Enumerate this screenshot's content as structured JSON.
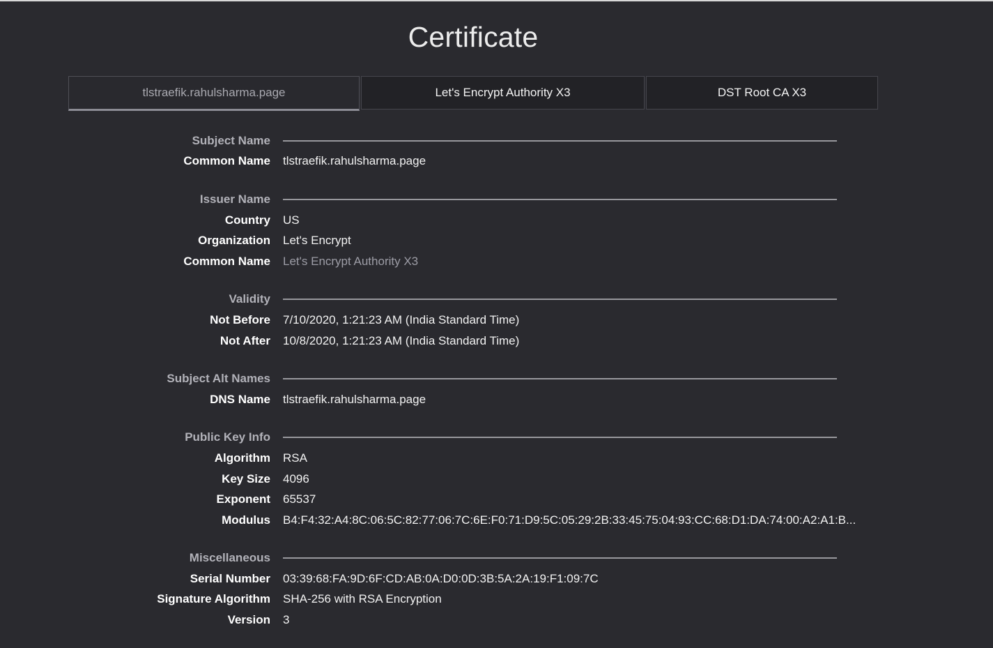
{
  "title": "Certificate",
  "tabs": [
    {
      "label": "tlstraefik.rahulsharma.page",
      "active": true
    },
    {
      "label": "Let's Encrypt Authority X3",
      "active": false
    },
    {
      "label": "DST Root CA X3",
      "active": false
    }
  ],
  "sections": {
    "subject_name": {
      "title": "Subject Name",
      "rows": [
        {
          "label": "Common Name",
          "value": "tlstraefik.rahulsharma.page"
        }
      ]
    },
    "issuer_name": {
      "title": "Issuer Name",
      "rows": [
        {
          "label": "Country",
          "value": "US"
        },
        {
          "label": "Organization",
          "value": "Let's Encrypt"
        },
        {
          "label": "Common Name",
          "value": "Let's Encrypt Authority X3"
        }
      ]
    },
    "validity": {
      "title": "Validity",
      "rows": [
        {
          "label": "Not Before",
          "value": "7/10/2020, 1:21:23 AM (India Standard Time)"
        },
        {
          "label": "Not After",
          "value": "10/8/2020, 1:21:23 AM (India Standard Time)"
        }
      ]
    },
    "subject_alt_names": {
      "title": "Subject Alt Names",
      "rows": [
        {
          "label": "DNS Name",
          "value": "tlstraefik.rahulsharma.page"
        }
      ]
    },
    "public_key_info": {
      "title": "Public Key Info",
      "rows": [
        {
          "label": "Algorithm",
          "value": "RSA"
        },
        {
          "label": "Key Size",
          "value": "4096"
        },
        {
          "label": "Exponent",
          "value": "65537"
        },
        {
          "label": "Modulus",
          "value": "B4:F4:32:A4:8C:06:5C:82:77:06:7C:6E:F0:71:D9:5C:05:29:2B:33:45:75:04:93:CC:68:D1:DA:74:00:A2:A1:B..."
        }
      ]
    },
    "miscellaneous": {
      "title": "Miscellaneous",
      "rows": [
        {
          "label": "Serial Number",
          "value": "03:39:68:FA:9D:6F:CD:AB:0A:D0:0D:3B:5A:2A:19:F1:09:7C"
        },
        {
          "label": "Signature Algorithm",
          "value": "SHA-256 with RSA Encryption"
        },
        {
          "label": "Version",
          "value": "3"
        }
      ]
    }
  }
}
